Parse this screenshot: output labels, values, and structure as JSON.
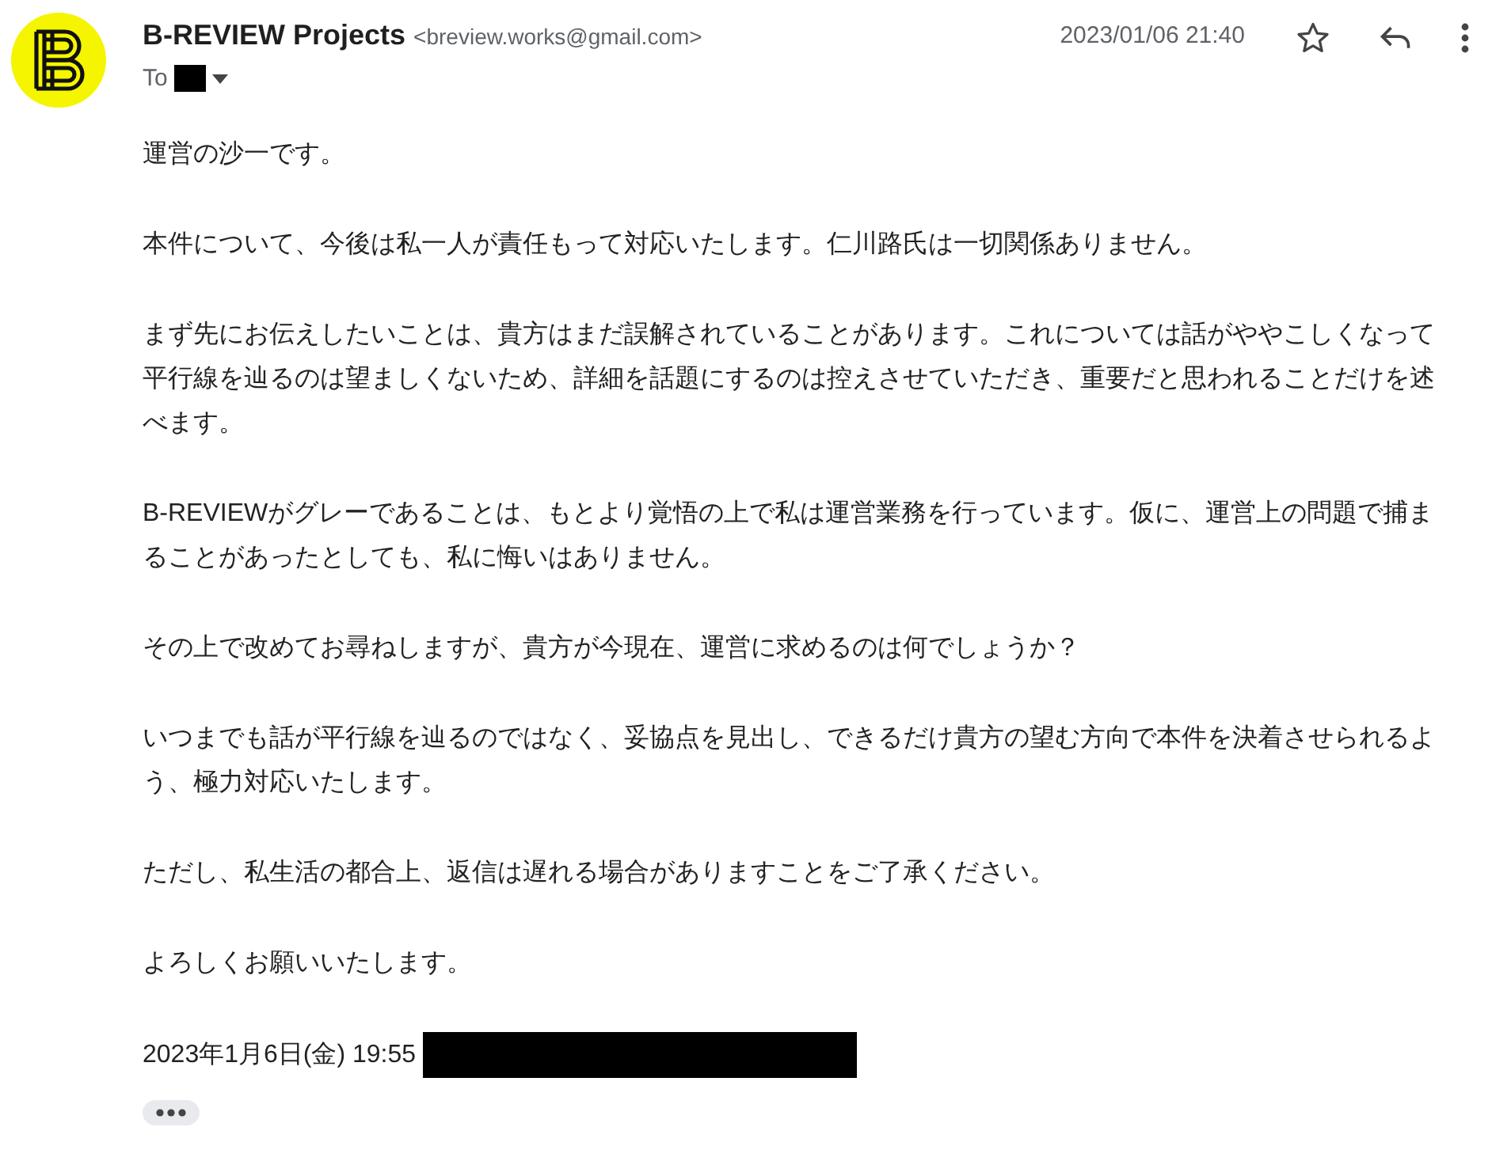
{
  "sender": {
    "name": "B-REVIEW Projects",
    "email": "<breview.works@gmail.com>"
  },
  "date": "2023/01/06 21:40",
  "starred": false,
  "to_label": "To",
  "body": [
    "運営の沙一です。",
    "本件について、今後は私一人が責任もって対応いたします。仁川路氏は一切関係ありません。",
    "まず先にお伝えしたいことは、貴方はまだ誤解されていることがあります。これについては話がややこしくなって平行線を辿るのは望ましくないため、詳細を話題にするのは控えさせていただき、重要だと思われることだけを述べます。",
    "B-REVIEWがグレーであることは、もとより覚悟の上で私は運営業務を行っています。仮に、運営上の問題で捕まることがあったとしても、私に悔いはありません。",
    "その上で改めてお尋ねしますが、貴方が今現在、運営に求めるのは何でしょうか？",
    "いつまでも話が平行線を辿るのではなく、妥協点を見出し、できるだけ貴方の望む方向で本件を決着させられるよう、極力対応いたします。",
    "ただし、私生活の都合上、返信は遅れる場合がありますことをご了承ください。",
    "よろしくお願いいたします。"
  ],
  "signature": "2023年1月6日(金) 19:55"
}
